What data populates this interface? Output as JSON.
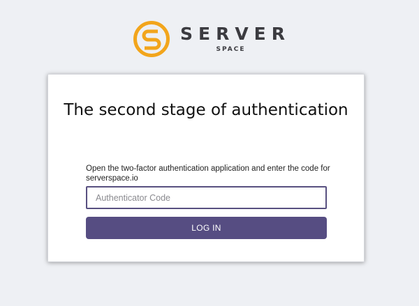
{
  "brand": {
    "name": "SERVER",
    "sub": "SPACE",
    "icon": "serverspace-logo-icon",
    "accent_color": "#f2a51c"
  },
  "card": {
    "title": "The second stage of authentication",
    "description": "Open the two-factor authentication application and enter the code for serverspace.io",
    "input": {
      "value": "",
      "placeholder": "Authenticator Code"
    },
    "button_label": "LOG IN",
    "button_color": "#564d82"
  }
}
